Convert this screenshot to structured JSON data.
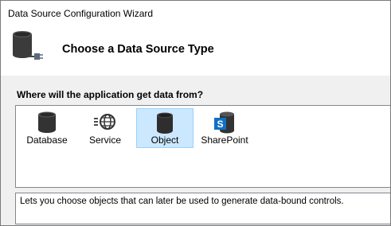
{
  "window": {
    "title": "Data Source Configuration Wizard"
  },
  "header": {
    "title": "Choose a Data Source Type",
    "icon": "database-plug-icon"
  },
  "main": {
    "question": "Where will the application get data from?",
    "items": [
      {
        "label": "Database",
        "icon": "database-icon",
        "selected": false
      },
      {
        "label": "Service",
        "icon": "service-globe-icon",
        "selected": false
      },
      {
        "label": "Object",
        "icon": "object-icon",
        "selected": true
      },
      {
        "label": "SharePoint",
        "icon": "sharepoint-icon",
        "selected": false
      }
    ],
    "description": "Lets you choose objects that can later be used to generate data-bound controls."
  },
  "colors": {
    "selection_bg": "#cce8ff",
    "selection_border": "#99d1ff",
    "sharepoint_blue": "#0f6fc6"
  }
}
